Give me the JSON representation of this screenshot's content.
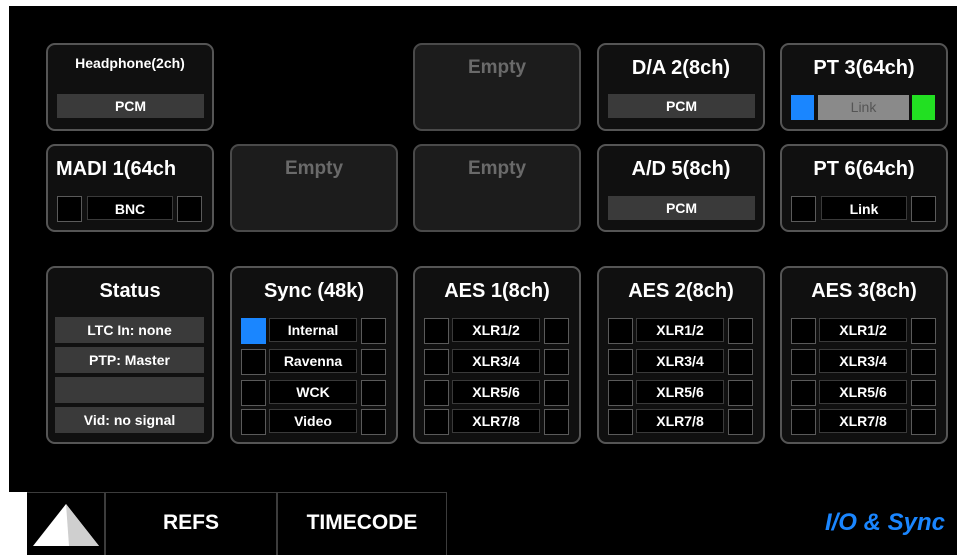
{
  "colors": {
    "background": "#000000",
    "card_border": "#555555",
    "bar": "#3a3a3a",
    "accent_blue": "#1a86ff",
    "accent_green": "#22e022",
    "empty_text": "#6a6a6a"
  },
  "slots": {
    "headphone": {
      "title": "Headphone(2ch)",
      "bar": "PCM"
    },
    "empty_top": {
      "title": "Empty"
    },
    "da2": {
      "title": "D/A 2(8ch)",
      "bar": "PCM"
    },
    "pt3": {
      "title": "PT 3(64ch)",
      "bar": "Link",
      "left_indicator": "blue",
      "right_indicator": "green"
    },
    "madi1": {
      "title": "MADI 1(64ch",
      "bar": "BNC"
    },
    "empty_mid1": {
      "title": "Empty"
    },
    "empty_mid2": {
      "title": "Empty"
    },
    "ad5": {
      "title": "A/D 5(8ch)",
      "bar": "PCM"
    },
    "pt6": {
      "title": "PT 6(64ch)",
      "bar": "Link"
    }
  },
  "status": {
    "title": "Status",
    "rows": [
      "LTC In: none",
      "PTP: Master",
      "",
      "Vid: no signal"
    ]
  },
  "sync": {
    "title": "Sync (48k)",
    "rows": [
      "Internal",
      "Ravenna",
      "WCK",
      "Video"
    ],
    "selected": "Internal"
  },
  "aes": [
    {
      "title": "AES 1(8ch)",
      "rows": [
        "XLR1/2",
        "XLR3/4",
        "XLR5/6",
        "XLR7/8"
      ]
    },
    {
      "title": "AES 2(8ch)",
      "rows": [
        "XLR1/2",
        "XLR3/4",
        "XLR5/6",
        "XLR7/8"
      ]
    },
    {
      "title": "AES 3(8ch)",
      "rows": [
        "XLR1/2",
        "XLR3/4",
        "XLR5/6",
        "XLR7/8"
      ]
    }
  ],
  "nav": {
    "home_icon": "triangle-icon",
    "refs": "REFS",
    "timecode": "TIMECODE",
    "page_label": "I/O & Sync"
  }
}
